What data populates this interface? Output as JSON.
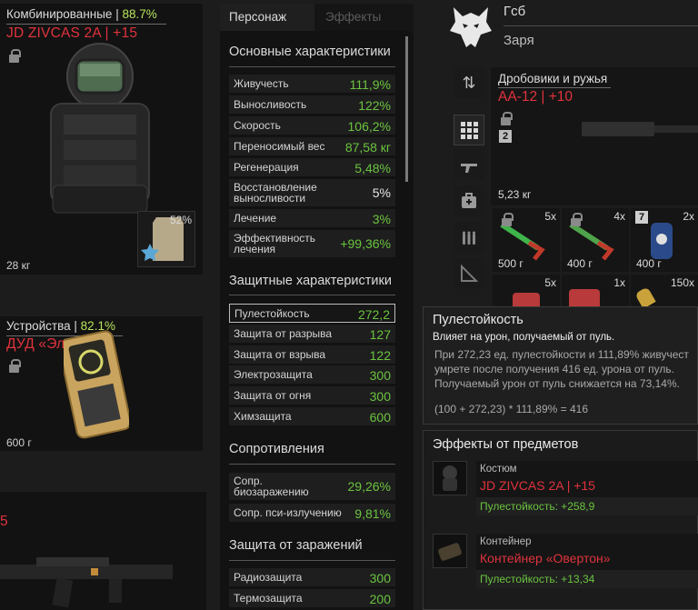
{
  "left": {
    "card1": {
      "category": "Комбинированные",
      "sep": "|",
      "percent": "88.7%",
      "title": "JD ZIVCAS 2A | +15",
      "container_percent": "52%",
      "weight": "28 кг"
    },
    "card2": {
      "category": "Устройства",
      "sep": "|",
      "percent": "82.1%",
      "title": "ДУД «Эльбрус»",
      "weight": "600 г"
    },
    "card3": {
      "fragment": "5"
    }
  },
  "stats": {
    "tabs": [
      "Персонаж",
      "Эффекты"
    ],
    "sections": [
      {
        "title": "Основные характеристики",
        "rows": [
          {
            "label": "Живучесть",
            "value": "111,9%"
          },
          {
            "label": "Выносливость",
            "value": "122%"
          },
          {
            "label": "Скорость",
            "value": "106,2%"
          },
          {
            "label": "Переносимый вес",
            "value": "87,58 кг"
          },
          {
            "label": "Регенерация",
            "value": "5,48%"
          },
          {
            "label": "Восстановление выносливости",
            "value": "5%"
          },
          {
            "label": "Лечение",
            "value": "3%"
          },
          {
            "label": "Эффективность лечения",
            "value": "+99,36%"
          }
        ]
      },
      {
        "title": "Защитные характеристики",
        "rows": [
          {
            "label": "Пулестойкость",
            "value": "272,2"
          },
          {
            "label": "Защита от разрыва",
            "value": "127"
          },
          {
            "label": "Защита от взрыва",
            "value": "122"
          },
          {
            "label": "Электрозащита",
            "value": "300"
          },
          {
            "label": "Защита от огня",
            "value": "300"
          },
          {
            "label": "Химзащита",
            "value": "600"
          }
        ]
      },
      {
        "title": "Сопротивления",
        "rows": [
          {
            "label": "Сопр. биозаражению",
            "value": "29,26%"
          },
          {
            "label": "Сопр. пси-излучению",
            "value": "9,81%"
          }
        ]
      },
      {
        "title": "Защита от заражений",
        "rows": [
          {
            "label": "Радиозащита",
            "value": "300"
          },
          {
            "label": "Термозащита",
            "value": "200"
          }
        ]
      }
    ]
  },
  "right": {
    "group": "Гсб",
    "subgroup": "Заря",
    "weapon": {
      "category": "Дробовики и ружья",
      "title": "AA-12 | +10",
      "slot_number": "2",
      "weight": "5,23 кг"
    },
    "slots": [
      {
        "count": "5x",
        "weight": "500 г"
      },
      {
        "count": "4x",
        "weight": "400 г"
      },
      {
        "count": "2x",
        "weight": "400 г",
        "badge": "7"
      },
      {
        "count": "5x"
      },
      {
        "count": "1x"
      },
      {
        "count": "150x"
      }
    ]
  },
  "tooltip": {
    "title": "Пулестойкость",
    "desc": "Влияет на урон, получаемый от пуль.",
    "lines": [
      "При 272,23 ед. пулестойкости и 111,89% живучест",
      "умрете после получения 416 ед. урона от пуль.",
      "Получаемый урон от пуль снижается на 73,14%."
    ],
    "formula": "(100 + 272,23) * 111,89% = 416"
  },
  "effects": {
    "title": "Эффекты от предметов",
    "items": [
      {
        "category": "Костюм",
        "name": "JD ZIVCAS 2A | +15",
        "bonus": "Пулестойкость: +258,9"
      },
      {
        "category": "Контейнер",
        "name": "Контейнер «Овертон»",
        "bonus": "Пулестойкость: +13,34"
      }
    ]
  },
  "colors": {
    "accent_red": "#e0333d",
    "accent_green": "#6bc43f",
    "percent_yellowgreen": "#b7e35a"
  }
}
